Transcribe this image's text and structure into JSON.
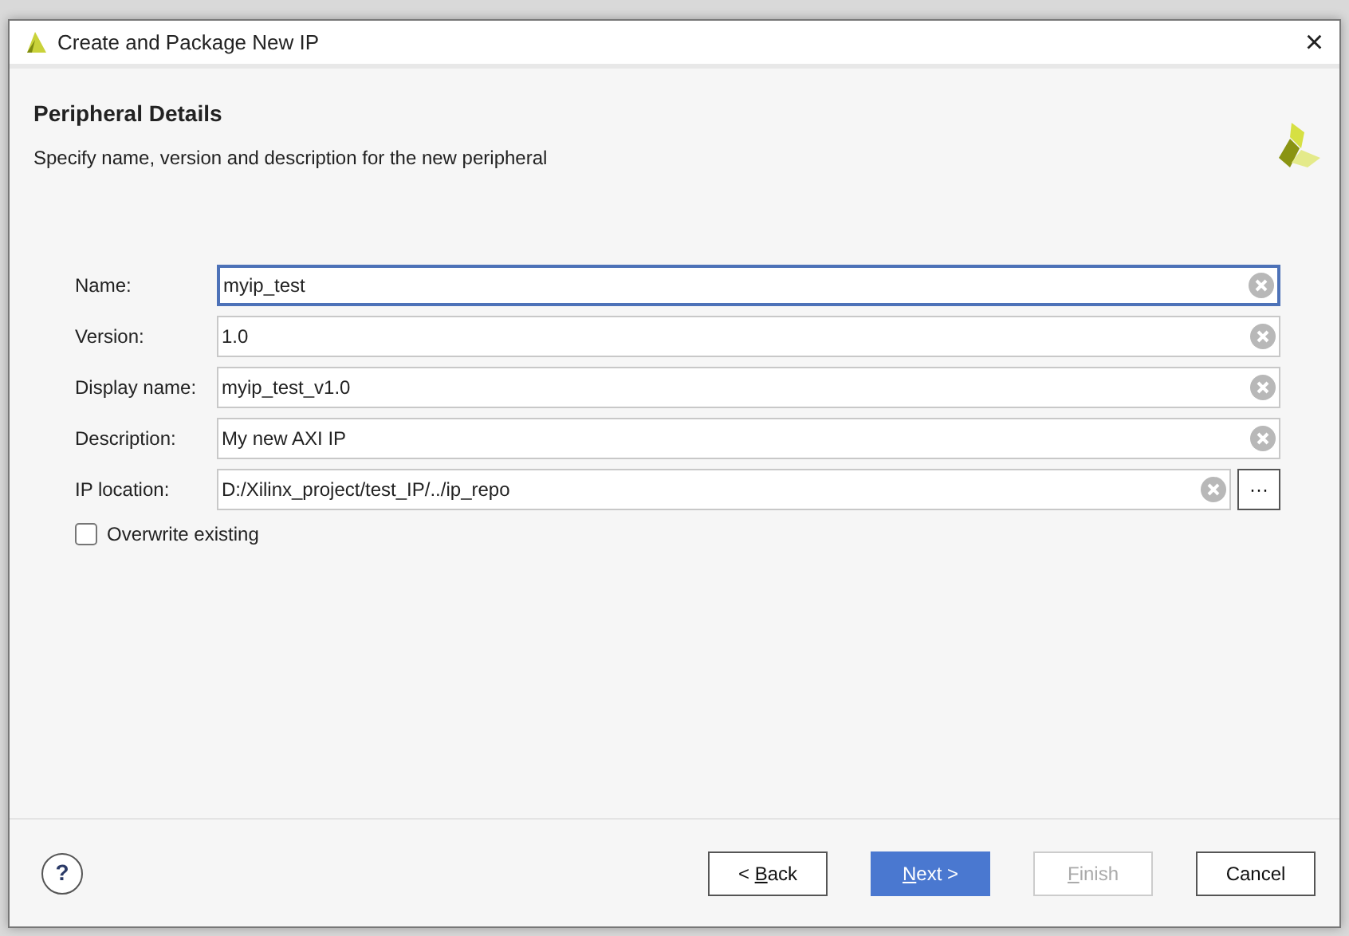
{
  "window": {
    "title": "Create and Package New IP",
    "close": "×"
  },
  "header": {
    "title": "Peripheral Details",
    "subtitle": "Specify name, version and description for the new peripheral"
  },
  "fields": [
    {
      "label": "Name:",
      "value": "myip_test",
      "focused": true,
      "browse": false
    },
    {
      "label": "Version:",
      "value": "1.0",
      "focused": false,
      "browse": false
    },
    {
      "label": "Display name:",
      "value": "myip_test_v1.0",
      "focused": false,
      "browse": false
    },
    {
      "label": "Description:",
      "value": "My new AXI IP",
      "focused": false,
      "browse": false
    },
    {
      "label": "IP location:",
      "value": "D:/Xilinx_project/test_IP/../ip_repo",
      "focused": false,
      "browse": true,
      "browse_label": "···"
    }
  ],
  "overwrite": {
    "label": "Overwrite existing",
    "checked": false
  },
  "help": "?",
  "buttons": [
    {
      "kind": "plain",
      "before": "< ",
      "key": "B",
      "after": "ack",
      "disabled": false
    },
    {
      "kind": "primary",
      "key": "N",
      "after": "ext >",
      "disabled": false
    },
    {
      "kind": "plain",
      "key": "F",
      "after": "inish",
      "disabled": true
    },
    {
      "kind": "plain",
      "after": "Cancel",
      "disabled": false
    }
  ]
}
